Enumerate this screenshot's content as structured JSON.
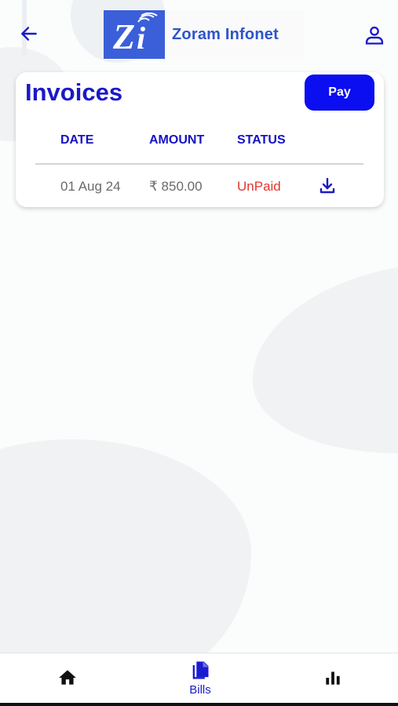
{
  "header": {
    "back_icon": "arrow-left-icon",
    "logo_text": "Zoram Infonet",
    "logo_mark": "Zi",
    "profile_icon": "user-icon"
  },
  "invoices": {
    "title": "Invoices",
    "pay_label": "Pay",
    "columns": [
      "DATE",
      "AMOUNT",
      "STATUS"
    ],
    "rows": [
      {
        "date": "01 Aug 24",
        "amount": "₹ 850.00",
        "status": "UnPaid",
        "action_icon": "download-icon"
      }
    ]
  },
  "tabbar": {
    "items": [
      {
        "icon": "home-icon",
        "label": ""
      },
      {
        "icon": "documents-icon",
        "label": "Bills"
      },
      {
        "icon": "bar-chart-icon",
        "label": ""
      }
    ]
  },
  "colors": {
    "primary": "#1b19c8",
    "button": "#0a0ef0",
    "status_unpaid": "#e2362f",
    "logo_bg": "#3b5fd9",
    "logo_text": "#2f54c9"
  }
}
